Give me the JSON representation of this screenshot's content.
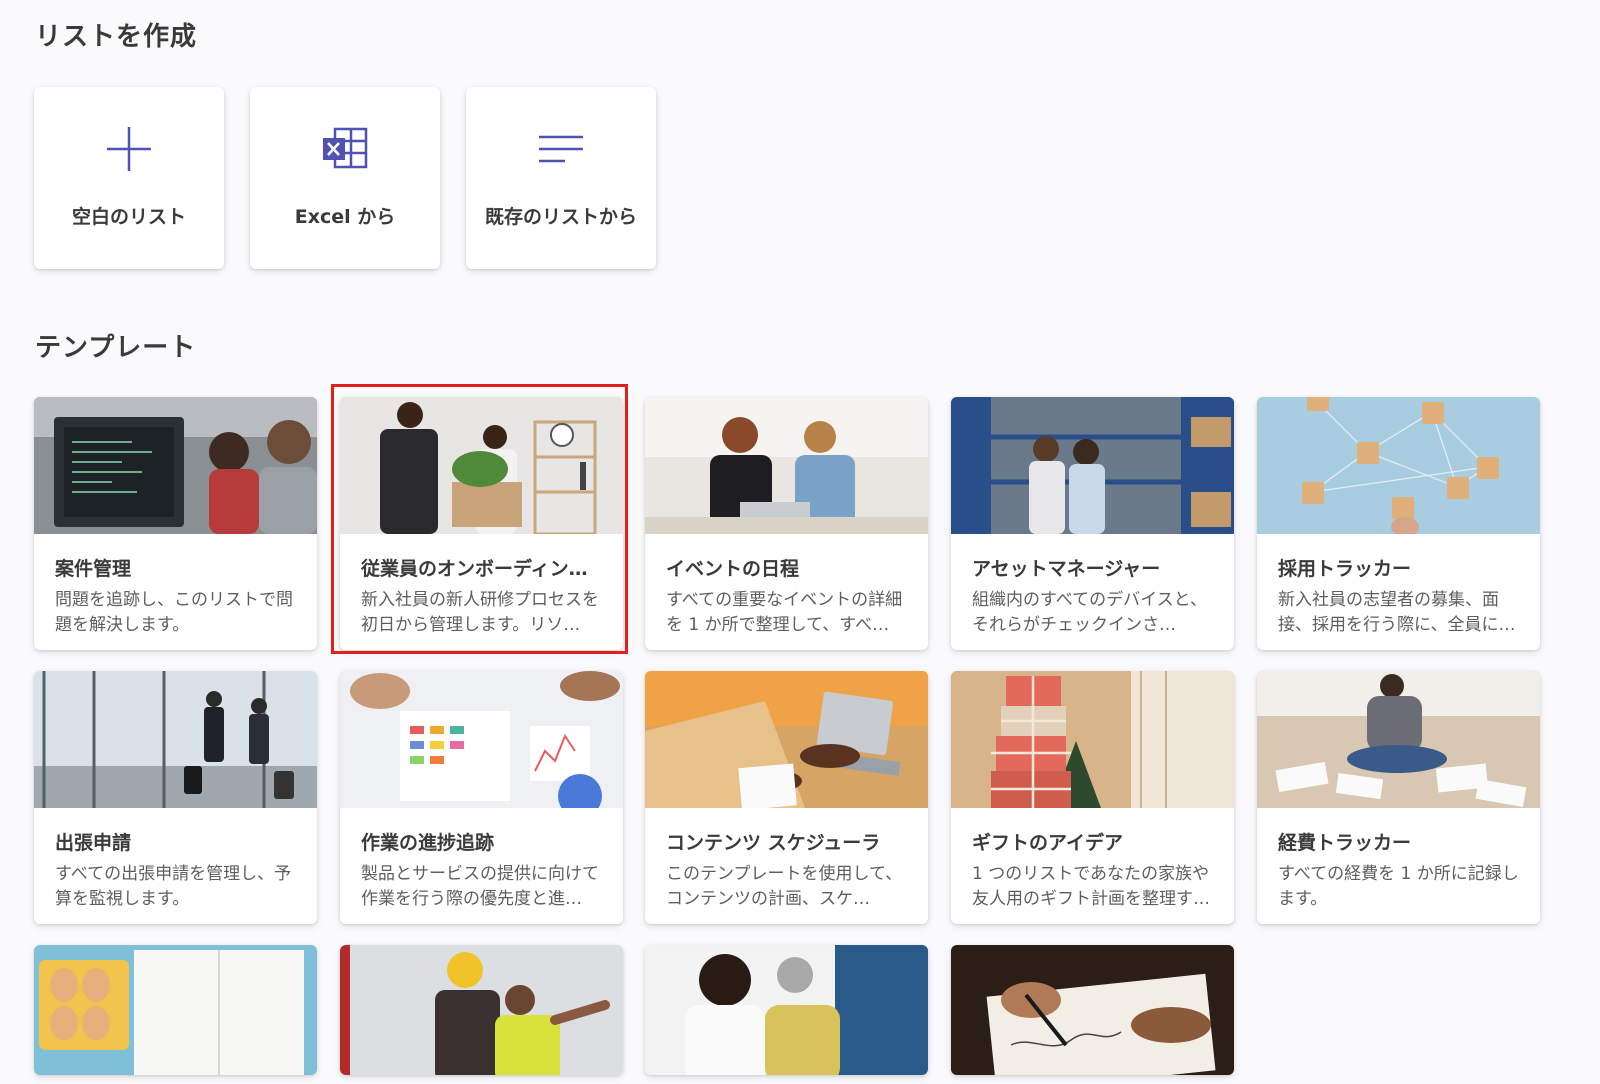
{
  "create_section": {
    "title": "リストを作成",
    "options": [
      {
        "label": "空白のリスト",
        "icon": "plus-icon"
      },
      {
        "label": "Excel から",
        "icon": "excel-icon"
      },
      {
        "label": "既存のリストから",
        "icon": "list-lines-icon"
      }
    ]
  },
  "templates_section": {
    "title": "テンプレート",
    "items": [
      {
        "title": "案件管理",
        "description": "問題を追跡し、このリストで問題を解決します。",
        "image": "developers-at-monitor"
      },
      {
        "title": "従業員のオンボーディン…",
        "description": "新入社員の新人研修プロセスを初日から管理します。リソ…",
        "image": "new-employee-with-box"
      },
      {
        "title": "イベントの日程",
        "description": "すべての重要なイベントの詳細を 1 か所で整理して、すべ…",
        "image": "women-planning-at-laptop"
      },
      {
        "title": "アセットマネージャー",
        "description": "組織内のすべてのデバイスと、それらがチェックインさ…",
        "image": "warehouse-workers"
      },
      {
        "title": "採用トラッカー",
        "description": "新入社員の志望者の募集、面接、採用を行う際に、全員に…",
        "image": "network-blocks"
      },
      {
        "title": "出張申請",
        "description": "すべての出張申請を管理し、予算を監視します。",
        "image": "travelers-at-airport"
      },
      {
        "title": "作業の進捗追跡",
        "description": "製品とサービスの提供に向けて作業を行う際の優先度と進…",
        "image": "charts-on-table"
      },
      {
        "title": "コンテンツ スケジューラ",
        "description": "このテンプレートを使用して、コンテンツの計画、スケ…",
        "image": "writing-at-laptop"
      },
      {
        "title": "ギフトのアイデア",
        "description": "1 つのリストであなたの家族や友人用のギフト計画を整理す…",
        "image": "stacked-gifts"
      },
      {
        "title": "経費トラッカー",
        "description": "すべての経費を 1 か所に記録します。",
        "image": "receipts-on-floor"
      },
      {
        "title": "",
        "description": "",
        "image": "eggs-and-notebook"
      },
      {
        "title": "",
        "description": "",
        "image": "firefighters"
      },
      {
        "title": "",
        "description": "",
        "image": "doctor-and-patient"
      },
      {
        "title": "",
        "description": "",
        "image": "signing-document"
      }
    ]
  },
  "colors": {
    "accent": "#4f52b2",
    "highlight": "#e0201c",
    "background": "#faf9fb"
  }
}
